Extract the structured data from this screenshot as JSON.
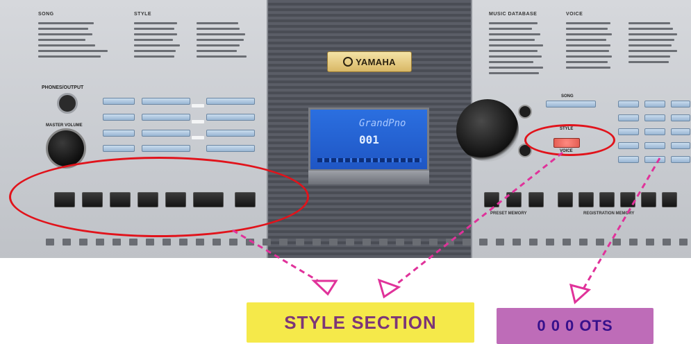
{
  "brand": {
    "name": "YAMAHA"
  },
  "panel": {
    "left_headings": [
      "SONG",
      "STYLE"
    ],
    "right_headings": [
      "MUSIC DATABASE",
      "VOICE"
    ],
    "jack_label": "PHONES/OUTPUT",
    "volume_label": "MASTER VOLUME",
    "song_label": "SONG",
    "style_label": "STYLE",
    "voice_label": "VOICE",
    "registration_label": "REGISTRATION MEMORY",
    "preset_label": "PRESET MEMORY"
  },
  "lcd": {
    "line1": "GrandPno",
    "line2": "001"
  },
  "annotations": {
    "style_section": "STYLE SECTION",
    "ots": "0 0 0  OTS"
  },
  "colors": {
    "highlight": "#e1131b",
    "arrow": "#e0329a",
    "style_box": "#f5e94a",
    "ots_box": "#be6cb8"
  }
}
